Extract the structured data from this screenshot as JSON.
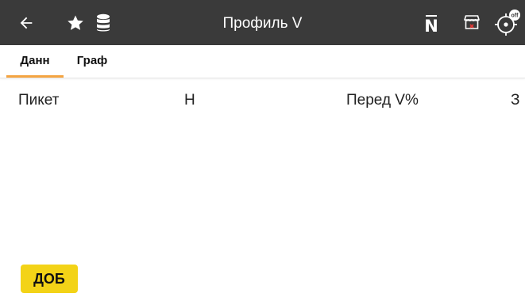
{
  "app_bar": {
    "title": "Профиль V",
    "icons": {
      "back": "back-arrow-icon",
      "favorite": "star-icon",
      "database": "database-icon",
      "n_bar": "N̄",
      "store": "store-icon",
      "gps": "gps-off-icon"
    },
    "gps_label": "off",
    "background": "#3a3a3a"
  },
  "tabs": [
    {
      "label": "Данн",
      "active": true
    },
    {
      "label": "Граф",
      "active": false
    }
  ],
  "accent_color": "#f4a441",
  "table": {
    "columns": [
      "Пикет",
      "H",
      "Перед V%",
      "З"
    ]
  },
  "add_button": {
    "label": "ДОБ",
    "color": "#f3d317"
  }
}
